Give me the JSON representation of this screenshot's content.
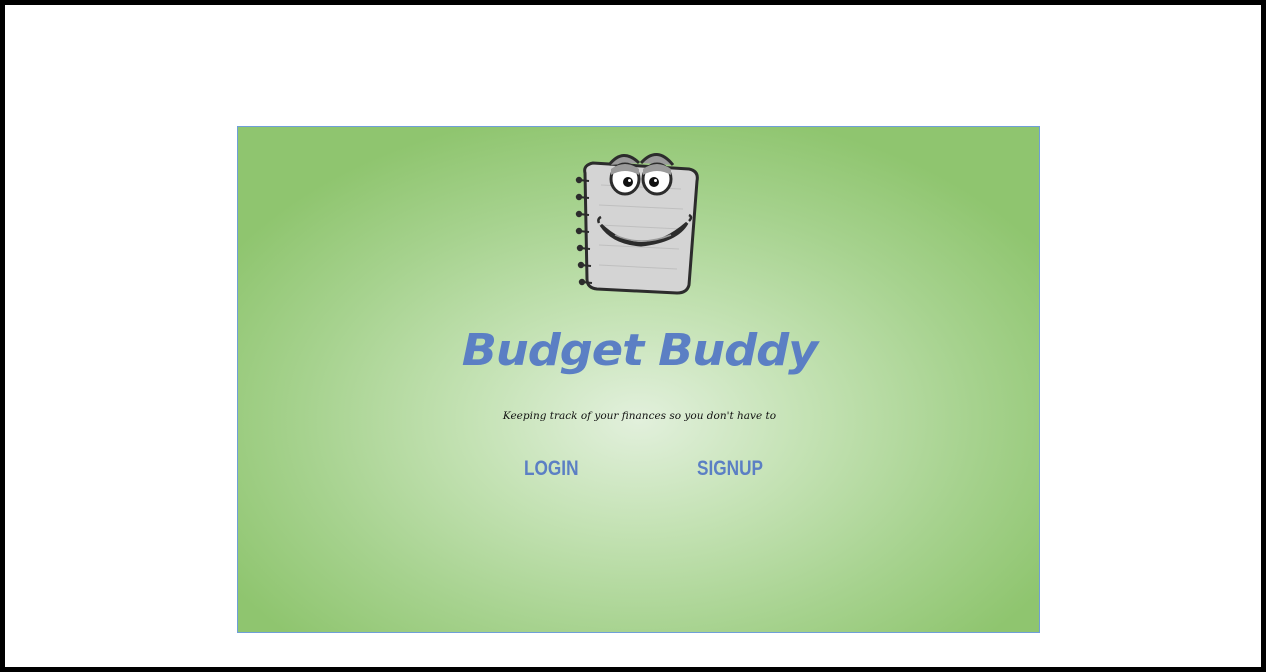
{
  "app": {
    "title": "Budget Buddy",
    "tagline": "Keeping track of your finances so you don't have to"
  },
  "nav": {
    "login_label": "LOGIN",
    "signup_label": "SIGNUP"
  },
  "mascot": {
    "icon": "notepad-mascot-icon"
  },
  "colors": {
    "accent": "#5b7fc4",
    "background_center": "#e2f0dc",
    "background_edge": "#8fc56f",
    "frame_border": "#000000"
  }
}
